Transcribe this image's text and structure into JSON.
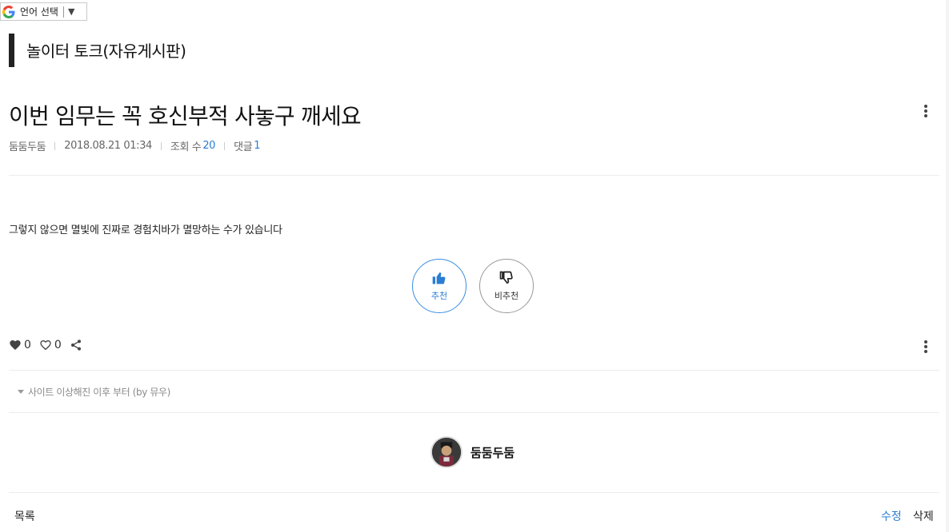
{
  "translate": {
    "label": "언어 선택",
    "arrow": "▼"
  },
  "board": {
    "title": "놀이터 토크(자유게시판)"
  },
  "post": {
    "title": "이번 임무는 꼭 호신부적 사놓구 깨세요",
    "author": "둠둠두둠",
    "date": "2018.08.21 01:34",
    "views_label": "조회 수",
    "views": "20",
    "comments_label": "댓글",
    "comments": "1",
    "body": "그렇지 않으면 멸빛에 진짜로 경험치바가 멸망하는 수가 있습니다"
  },
  "votes": {
    "up_label": "추천",
    "down_label": "비추천"
  },
  "reactions": {
    "likes": "0",
    "favorites": "0"
  },
  "related": {
    "text": "사이트 이상해진 이후 부터 (by 뮤우)"
  },
  "author_box": {
    "name": "둠둠두둠"
  },
  "footer": {
    "list_label": "목록",
    "edit_label": "수정",
    "delete_label": "삭제"
  },
  "colors": {
    "accent": "#2b7cd3",
    "title_bar": "#222222"
  },
  "icons": [
    "google-g-icon",
    "kebab-icon",
    "thumbs-up-icon",
    "thumbs-down-icon",
    "heart-icon",
    "heart-outline-icon",
    "share-icon",
    "caret-down-icon"
  ]
}
